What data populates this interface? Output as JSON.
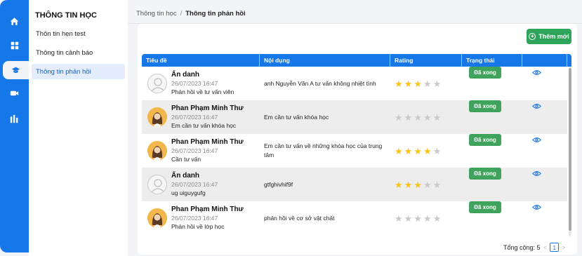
{
  "rail": {
    "items": [
      {
        "icon": "home-icon",
        "active": false
      },
      {
        "icon": "grid-icon",
        "active": false
      },
      {
        "icon": "graduation-cap-icon",
        "active": true
      },
      {
        "icon": "video-camera-icon",
        "active": false
      },
      {
        "icon": "chart-icon",
        "active": false
      }
    ]
  },
  "subnav": {
    "title": "THÔNG TIN HỌC",
    "items": [
      {
        "label": "Thôn tin hẹn test"
      },
      {
        "label": "Thông tin cảnh báo"
      },
      {
        "label": "Thông tin phản hồi"
      }
    ]
  },
  "breadcrumb": {
    "parent": "Thông tin học",
    "separator": "/",
    "current": "Thông tin phản hồi"
  },
  "toolbar": {
    "add_label": "Thêm mới"
  },
  "table": {
    "columns": [
      "Tiêu đề",
      "Nội dụng",
      "Rating",
      "Trạng thái",
      ""
    ],
    "rows": [
      {
        "name": "Ẩn danh",
        "date": "26/07/2023 16:47",
        "subject": "Phản hồi về tư vấn viên",
        "content": "anh Nguyễn Văn A tư vấn không nhiệt tình",
        "rating": 3,
        "status": "Đã xong",
        "avatar": "anonymous"
      },
      {
        "name": "Phan Phạm Minh Thư",
        "date": "26/07/2023 16:47",
        "subject": "Em cần tư vấn khóa học",
        "content": "Em cần tư vấn khóa học",
        "rating": 0,
        "status": "Đã xong",
        "avatar": "photo"
      },
      {
        "name": "Phan Phạm Minh Thư",
        "date": "26/07/2023 16:47",
        "subject": "Cần tư vấn",
        "content": "Em cần tư vấn về những khóa học của trung tâm",
        "rating": 4,
        "status": "Đã xong",
        "avatar": "photo"
      },
      {
        "name": "Ẩn danh",
        "date": "26/07/2023 16:47",
        "subject": "ug uiguygufg",
        "content": "gtfghivhif9f",
        "rating": 3,
        "status": "Đã xong",
        "avatar": "anonymous"
      },
      {
        "name": "Phan Phạm Minh Thư",
        "date": "26/07/2023 16:47",
        "subject": "Phản hồi về lớp học",
        "content": "phản hồi về cơ sở vật chất",
        "rating": 0,
        "status": "Đã xong",
        "avatar": "photo"
      }
    ]
  },
  "footer": {
    "total_label": "Tổng cộng: 5",
    "current_page": "1",
    "prev": "<",
    "next": ">"
  },
  "colors": {
    "primary": "#1677e8",
    "success": "#3fa35e",
    "star": "#f5c518"
  }
}
